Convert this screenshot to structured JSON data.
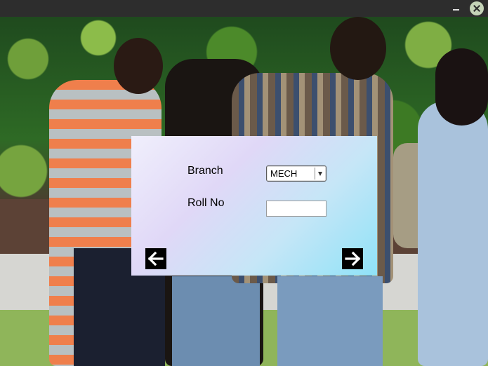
{
  "window": {
    "minimize_glyph": "–",
    "close_glyph": "×"
  },
  "form": {
    "branch_label": "Branch",
    "branch_value": "MECH",
    "roll_label": "Roll No",
    "roll_value": ""
  },
  "icons": {
    "back": "arrow-left-icon",
    "next": "arrow-right-icon"
  },
  "colors": {
    "titlebar": "#2d2d2d",
    "dialog_start": "#f0effc",
    "dialog_end": "#8fe2f7"
  }
}
